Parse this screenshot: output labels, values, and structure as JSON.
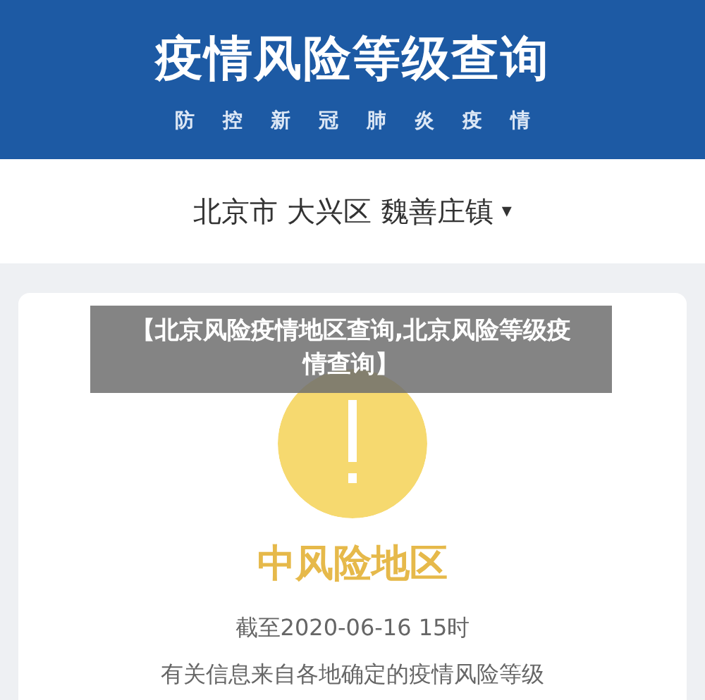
{
  "header": {
    "title": "疫情风险等级查询",
    "subtitle": [
      "防",
      "控",
      "新",
      "冠",
      "肺",
      "炎",
      "疫",
      "情"
    ]
  },
  "location": {
    "text": "北京市 大兴区 魏善庄镇",
    "caret": "▾"
  },
  "result": {
    "kind": "medium",
    "label": "中风险地区",
    "as_of": "截至2020-06-16 15时",
    "note": "有关信息来自各地确定的疫情风险等级"
  },
  "caption": "【北京风险疫情地区查询,北京风险等级疫情查询】"
}
